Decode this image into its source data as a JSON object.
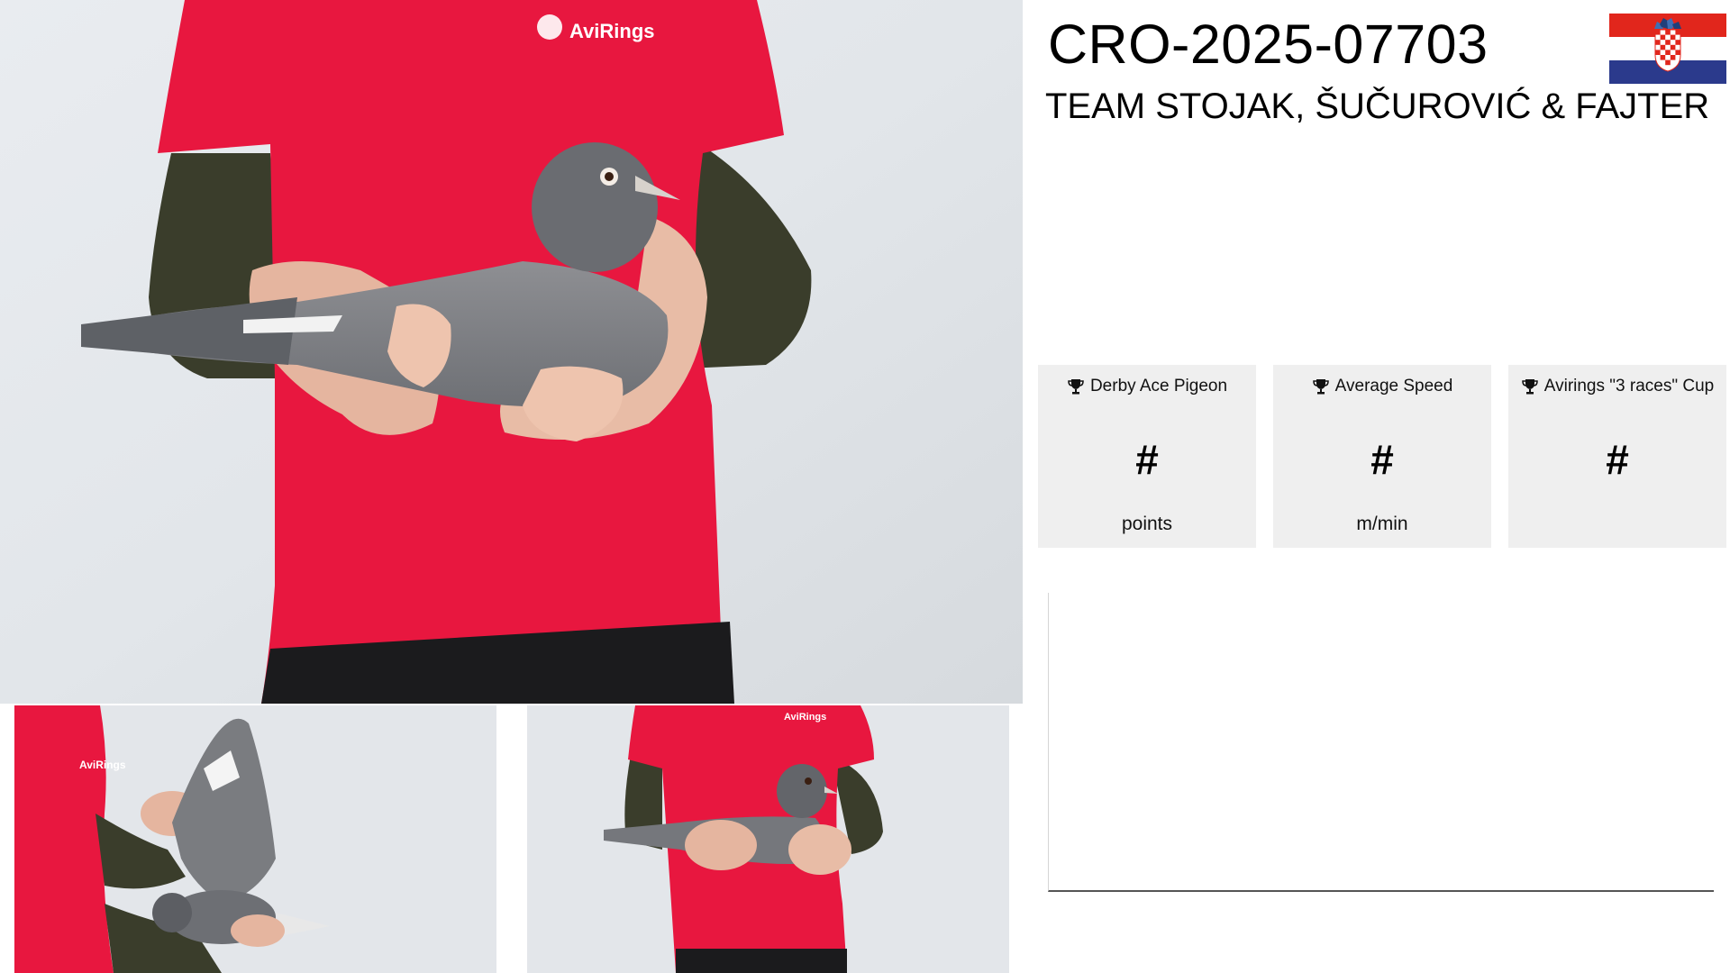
{
  "pigeon": {
    "ring_number": "CRO-2025-07703",
    "owner": "TEAM STOJAK, ŠUČUROVIĆ & FAJTER",
    "country_flag": "croatia-flag-icon"
  },
  "photos": {
    "main": {
      "name": "pigeon-main-photo",
      "shirt_logo": "AviRings"
    },
    "wing": {
      "name": "pigeon-wing-photo",
      "shirt_logo": "AviRings"
    },
    "side": {
      "name": "pigeon-side-photo",
      "shirt_logo": "AviRings"
    }
  },
  "stats": [
    {
      "title": "Derby Ace Pigeon",
      "value": "#",
      "unit": "points",
      "icon": "trophy-icon"
    },
    {
      "title": "Average Speed",
      "value": "#",
      "unit": "m/min",
      "icon": "trophy-icon"
    },
    {
      "title": "Avirings \"3 races\" Cup",
      "value": "#",
      "unit": "",
      "icon": "trophy-icon"
    }
  ],
  "colors": {
    "shirt": "#e8173f",
    "sleeve": "#3a3d2b",
    "card_bg": "#efefef",
    "flag_red": "#e1261c",
    "flag_white": "#ffffff",
    "flag_blue": "#2b3a8c"
  }
}
